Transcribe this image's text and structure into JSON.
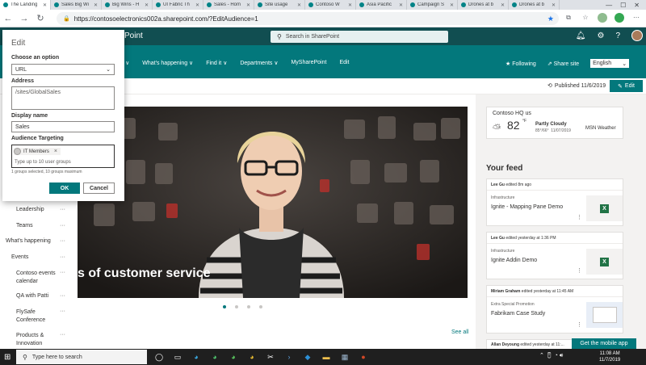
{
  "browser": {
    "tabs": [
      {
        "label": "The Landing",
        "active": true
      },
      {
        "label": "Sales Big Wi",
        "active": false
      },
      {
        "label": "Big Wins - H",
        "active": false
      },
      {
        "label": "UI Fabric Th",
        "active": false
      },
      {
        "label": "Sales - Hom",
        "active": false
      },
      {
        "label": "Site usage",
        "active": false
      },
      {
        "label": "Contoso W",
        "active": false
      },
      {
        "label": "Asia Pacific",
        "active": false
      },
      {
        "label": "Campaign S",
        "active": false
      },
      {
        "label": "Drones at b",
        "active": false
      },
      {
        "label": "Drones at b",
        "active": false
      }
    ],
    "url": "https://contosoelectronics002a.sharepoint.com/?EditAudience=1"
  },
  "suite": {
    "app_name": "Point",
    "search_placeholder": "Search in SharePoint"
  },
  "site_nav": {
    "items": [
      "re ∨",
      "What's happening ∨",
      "Find it ∨",
      "Departments ∨",
      "MySharePoint",
      "Edit"
    ],
    "following_label": "Following",
    "share_label": "Share site",
    "language": "English"
  },
  "command_bar": {
    "published": "Published 11/6/2019",
    "edit_label": "Edit"
  },
  "left_nav": [
    {
      "label": "Leadership",
      "indent": true
    },
    {
      "label": "Teams",
      "indent": true
    },
    {
      "label": "What's happening",
      "indent": false
    },
    {
      "label": "Events",
      "indent": true
    },
    {
      "label": "Contoso events calendar",
      "indent": true,
      "sub": true
    },
    {
      "label": "QA with Patti",
      "indent": true,
      "sub": true
    },
    {
      "label": "FlySafe Conference",
      "indent": true,
      "sub": true
    },
    {
      "label": "Products & Innovation",
      "indent": true,
      "sub": true
    }
  ],
  "hero": {
    "caption": "s of customer service",
    "dots": 4,
    "active_dot": 0,
    "see_all": "See all"
  },
  "weather": {
    "location": "Contoso HQ us",
    "temp": "82",
    "unit": "°F",
    "condition": "Partly Cloudy",
    "range": "85°/66°",
    "date": "11/07/2019",
    "source": "MSN Weather"
  },
  "feed": {
    "title": "Your feed",
    "items": [
      {
        "author": "Lee Gu",
        "action": "edited 8m ago",
        "category": "Infrastructure",
        "title": "Ignite - Mapping Pane Demo"
      },
      {
        "author": "Lee Gu",
        "action": "edited yesterday at 1:36 PM",
        "category": "Infrastructure",
        "title": "Ignite Addin Demo"
      },
      {
        "author": "Miriam Graham",
        "action": "edited yesterday at 11:45 AM",
        "category": "Extra Special Promotion",
        "title": "Fabrikam Case Study"
      },
      {
        "author": "Allan Deyoung",
        "action": "edited yesterday at 11:..."
      }
    ],
    "mobile_app": "Get the mobile app"
  },
  "edit_panel": {
    "title": "Edit",
    "option_label": "Choose an option",
    "option_value": "URL",
    "address_label": "Address",
    "address_value": "/sites/GlobalSales",
    "display_name_label": "Display name",
    "display_name_value": "Sales",
    "audience_label": "Audience Targeting",
    "audience_chip": "IT Members",
    "audience_placeholder": "Type up to 10 user groups",
    "audience_hint": "1 groups selected, 10 groups maximum",
    "ok_label": "OK",
    "cancel_label": "Cancel"
  },
  "taskbar": {
    "search_placeholder": "Type here to search",
    "time": "11:08 AM",
    "date": "11/7/2019"
  }
}
